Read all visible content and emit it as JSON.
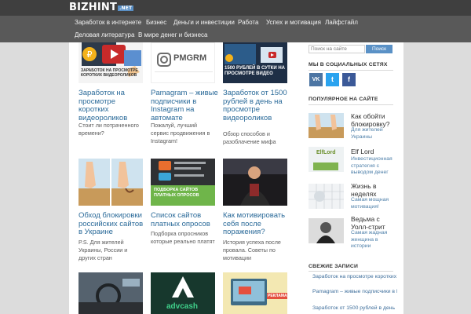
{
  "site": {
    "logo": "BIZHINT",
    "logo_sub": ".NET"
  },
  "nav": {
    "row1": [
      "Заработок в интернете",
      "Бизнес",
      "Деньги и инвестиции",
      "Работа",
      "Успех и мотивация",
      "Лайфстайл"
    ],
    "row2": [
      "Деловая литература",
      "В мире денег и бизнеса"
    ]
  },
  "cards": [
    {
      "title": "Заработок на просмотре коротких видеороликов",
      "desc": "Стоит ли потраченного времени?",
      "thumb_text": "ЗАРАБОТОК НА ПРОСМОТРЕ КОРОТКИХ ВИДЕОРОЛИКОВ"
    },
    {
      "title": "Pamagram – живые подписчики в Instagram на автомате",
      "desc": "Пожалуй, лучший сервис продвижения в Instagram!",
      "thumb_text": "PMGRM"
    },
    {
      "title": "Заработок от 1500 рублей в день на просмотре видеороликов",
      "desc": "Обзор способов и разоблачение мифа",
      "thumb_text": "1500 РУБЛЕЙ В СУТКИ НА ПРОСМОТРЕ ВИДЕО"
    },
    {
      "title": "Обход блокировки российских сайтов в Украине",
      "desc": "P.S. Для жителей Украины, России и других стран",
      "thumb_text": ""
    },
    {
      "title": "Список сайтов платных опросов",
      "desc": "Подборка опросников которые реально платят",
      "thumb_text": "ПОДБОРКА САЙТОВ ПЛАТНЫХ ОПРОСОВ"
    },
    {
      "title": "Как мотивировать себя после поражения?",
      "desc": "История успеха после провала. Советы по мотивации",
      "thumb_text": ""
    },
    {
      "title": "",
      "desc": "",
      "thumb_text": ""
    },
    {
      "title": "",
      "desc": "",
      "thumb_text": "advcash"
    },
    {
      "title": "",
      "desc": "",
      "thumb_text": "РЕКЛАМА"
    }
  ],
  "sidebar": {
    "search_placeholder": "Поиск на сайте",
    "search_button": "Поиск",
    "social_heading": "МЫ В СОЦИАЛЬНЫХ СЕТЯХ",
    "social": [
      {
        "icon": "vk-icon",
        "glyph": "VK",
        "color": "#4c75a3"
      },
      {
        "icon": "twitter-icon",
        "glyph": "t",
        "color": "#2aa3ef"
      },
      {
        "icon": "facebook-icon",
        "glyph": "f",
        "color": "#3b5998"
      }
    ],
    "popular_heading": "ПОПУЛЯРНОЕ НА САЙТЕ",
    "popular": [
      {
        "title": "Как обойти блокировку?",
        "desc": "Для жителей Украины"
      },
      {
        "title": "Elf Lord",
        "desc": "Инвестиционная стратегия с выводом денег",
        "thumb_text": "ElfLord"
      },
      {
        "title": "Жизнь в неделях",
        "desc": "Самая мощная мотивация!"
      },
      {
        "title": "Ведьма с Уолл-стрит",
        "desc": "Самая жадная женщина в истории"
      }
    ],
    "recent_heading": "СВЕЖИЕ ЗАПИСИ",
    "recent": [
      "Заработок на просмотре коротких видеороликов",
      "Pamagram – живые подписчики в Instagram на автомате",
      "Заработок от 1500 рублей в день"
    ]
  }
}
